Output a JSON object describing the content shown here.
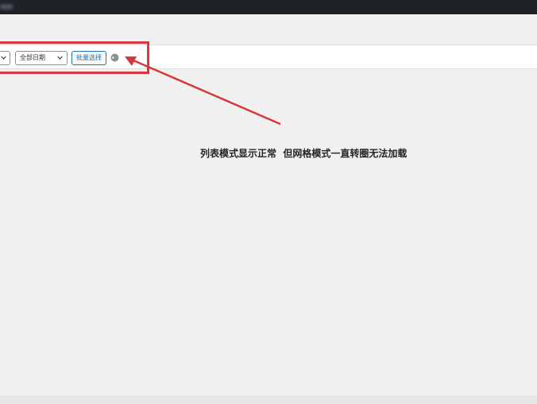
{
  "toolbar": {
    "date_filter_value": "全部日期",
    "bulk_select_label": "批量选择",
    "chevron_icon": "chevron-down-icon",
    "spinner_icon": "loading-spinner-icon"
  },
  "annotation": {
    "text": "列表模式显示正常  但网格模式一直转圈无法加载"
  },
  "colors": {
    "admin_bar": "#1d2327",
    "background": "#f0f0f1",
    "accent": "#2271b1",
    "highlight": "#d9363e"
  }
}
